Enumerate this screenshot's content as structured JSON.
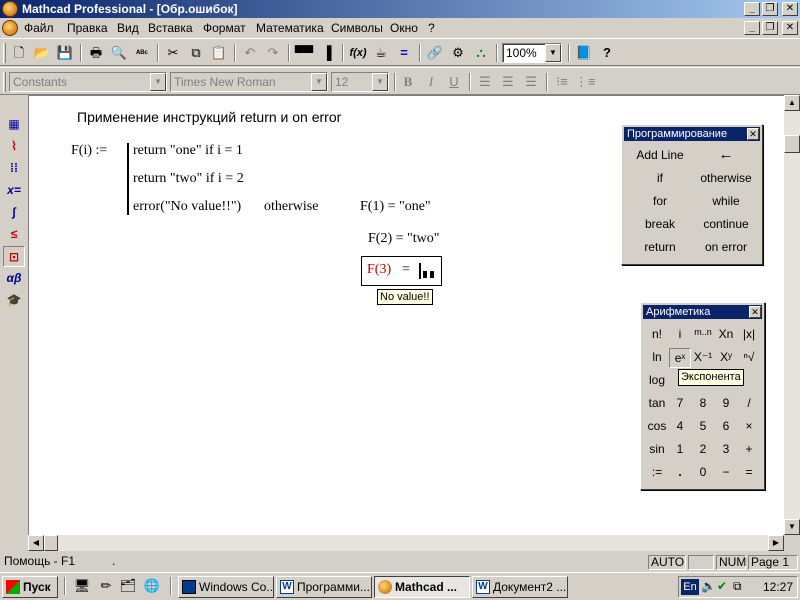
{
  "window": {
    "title": "Mathcad Professional - [Обр.ошибок]"
  },
  "menu": {
    "items": [
      {
        "label": "Файл"
      },
      {
        "label": "Правка"
      },
      {
        "label": "Вид"
      },
      {
        "label": "Вставка"
      },
      {
        "label": "Формат"
      },
      {
        "label": "Математика"
      },
      {
        "label": "Символы"
      },
      {
        "label": "Окно"
      },
      {
        "label": "?"
      }
    ]
  },
  "toolbar": {
    "zoom": "100%"
  },
  "format_bar": {
    "style": "Constants",
    "font": "Times New Roman",
    "size": "12"
  },
  "worksheet": {
    "heading": "Применение инструкций return и on error",
    "def_lhs": "F(i) :=",
    "line1": "return \"one\"  if  i = 1",
    "line2": "return \"two\"  if  i = 2",
    "line3_a": "error(\"No value!!\")",
    "line3_b": "otherwise",
    "eval1": "F(1) = \"one\"",
    "eval2": "F(2) = \"two\"",
    "eval3_lhs": "F(3)",
    "eval3_eq": "=",
    "error_tip": "No value!!"
  },
  "programming_palette": {
    "title": "Программирование",
    "buttons": [
      {
        "label": "Add Line"
      },
      {
        "label": "←"
      },
      {
        "label": "if"
      },
      {
        "label": "otherwise"
      },
      {
        "label": "for"
      },
      {
        "label": "while"
      },
      {
        "label": "break"
      },
      {
        "label": "continue"
      },
      {
        "label": "return"
      },
      {
        "label": "on error"
      }
    ]
  },
  "arithmetic_palette": {
    "title": "Арифметика",
    "tooltip": "Экспонента",
    "rows": [
      [
        "n!",
        "i",
        "m..n",
        "Xn",
        "|x|"
      ],
      [
        "ln",
        "eˣ",
        "X⁻¹",
        "Xʸ",
        "ⁿ√"
      ],
      [
        "log",
        "",
        "",
        "",
        ""
      ],
      [
        "tan",
        "7",
        "8",
        "9",
        "/"
      ],
      [
        "cos",
        "4",
        "5",
        "6",
        "×"
      ],
      [
        "sin",
        "1",
        "2",
        "3",
        "+"
      ],
      [
        ":=",
        ".",
        "0",
        "−",
        "="
      ]
    ]
  },
  "status": {
    "help": "Помощь - F1",
    "dot": ".",
    "auto": "AUTO",
    "num": "NUM",
    "page": "Page 1"
  },
  "taskbar": {
    "start": "Пуск",
    "tasks": [
      {
        "label": "Windows Co..."
      },
      {
        "label": "Программи..."
      },
      {
        "label": "Mathcad ..."
      },
      {
        "label": "Документ2 ..."
      }
    ],
    "lang": "En",
    "clock": "12:27"
  },
  "colors": {
    "title_bar": "#0a246a",
    "error_red": "#c00000",
    "face": "#d4d0c8"
  }
}
